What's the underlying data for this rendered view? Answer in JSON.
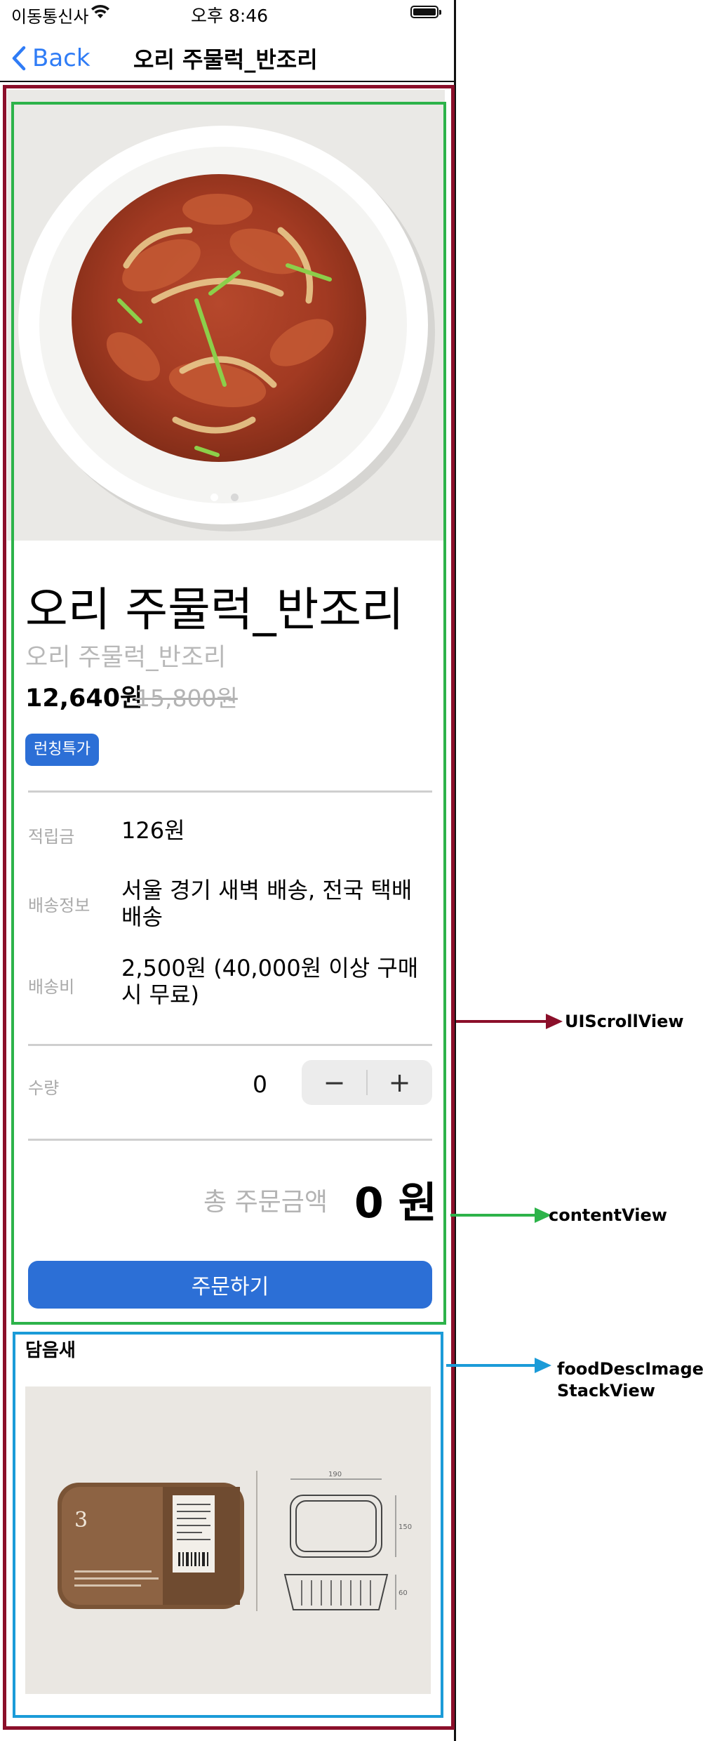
{
  "status_bar": {
    "carrier": "이동통신사",
    "time": "오후 8:46"
  },
  "nav": {
    "back_label": "Back",
    "title": "오리 주물럭_반조리"
  },
  "product": {
    "name": "오리 주물럭_반조리",
    "subtitle": "오리 주물럭_반조리",
    "price": "12,640원",
    "original_price": "15,800원",
    "badge": "런칭특가",
    "image_pages": 2,
    "current_page": 1
  },
  "info": [
    {
      "label": "적립금",
      "value": "126원"
    },
    {
      "label": "배송정보",
      "value": "서울 경기 새벽 배송, 전국 택배 배송"
    },
    {
      "label": "배송비",
      "value": "2,500원 (40,000원 이상 구매시 무료)"
    }
  ],
  "quantity": {
    "label": "수량",
    "value": "0",
    "minus": "−",
    "plus": "+"
  },
  "total": {
    "label": "총 주문금액",
    "amount": "0 원"
  },
  "order_button": "주문하기",
  "desc_section": {
    "title": "담음새",
    "pack_label_number": "3",
    "dims": {
      "width": "190",
      "depth": "150",
      "height": "60"
    }
  },
  "annotations": {
    "scroll_view": "UIScrollView",
    "content_view": "contentView",
    "stack_view_line1": "foodDescImage",
    "stack_view_line2": "StackView"
  },
  "colors": {
    "accent": "#2c6fd6",
    "back_blue": "#2f7cf6",
    "annotation_red": "#8b0f2a",
    "annotation_green": "#2db34a",
    "annotation_blue": "#1b9bd8"
  }
}
